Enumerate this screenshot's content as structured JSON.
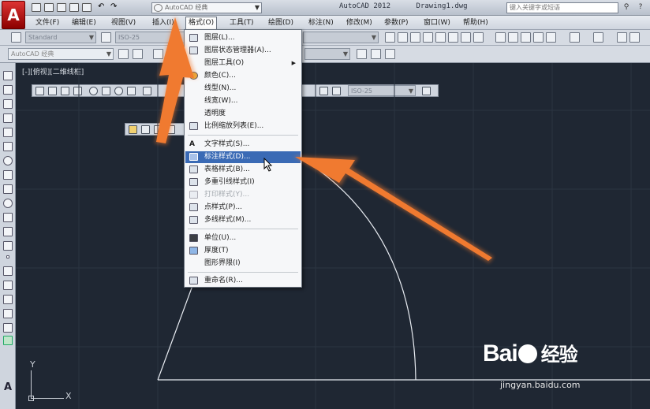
{
  "titlebar": {
    "workspace": "AutoCAD 经典",
    "app_title": "AutoCAD 2012",
    "doc_name": "Drawing1.dwg",
    "search_placeholder": "键入关键字或短语"
  },
  "menubar": {
    "items": [
      "文件(F)",
      "编辑(E)",
      "视图(V)",
      "插入(I)",
      "格式(O)",
      "工具(T)",
      "绘图(D)",
      "标注(N)",
      "修改(M)",
      "参数(P)",
      "窗口(W)",
      "帮助(H)"
    ],
    "active_index": 4
  },
  "toolbar1": {
    "text_style": "Standard",
    "dim_style": "ISO-25"
  },
  "toolbar2": {
    "workspace": "AutoCAD 经典"
  },
  "viewport": {
    "label": "[-][俯视][二维线框]",
    "dim_style_combo": "ISO-25"
  },
  "format_menu": {
    "items": [
      {
        "label": "图层(L)...",
        "icon": "layers-icon"
      },
      {
        "label": "图层状态管理器(A)...",
        "icon": "layer-state-icon"
      },
      {
        "label": "图层工具(O)",
        "icon": "",
        "submenu": true
      },
      {
        "label": "颜色(C)...",
        "icon": "color-wheel-icon"
      },
      {
        "label": "线型(N)...",
        "icon": ""
      },
      {
        "label": "线宽(W)...",
        "icon": ""
      },
      {
        "label": "透明度",
        "icon": ""
      },
      {
        "label": "比例缩放列表(E)...",
        "icon": "scale-list-icon"
      },
      {
        "label": "文字样式(S)...",
        "icon": "text-style-icon"
      },
      {
        "label": "标注样式(D)...",
        "icon": "dim-style-icon",
        "highlight": true
      },
      {
        "label": "表格样式(B)...",
        "icon": "table-style-icon"
      },
      {
        "label": "多重引线样式(I)",
        "icon": "mleader-style-icon"
      },
      {
        "label": "打印样式(Y)...",
        "icon": "plot-style-icon",
        "disabled": true
      },
      {
        "label": "点样式(P)...",
        "icon": "point-style-icon"
      },
      {
        "label": "多线样式(M)...",
        "icon": "mline-style-icon"
      },
      {
        "label": "单位(U)...",
        "icon": "units-icon"
      },
      {
        "label": "厚度(T)",
        "icon": "thickness-icon"
      },
      {
        "label": "图形界限(I)",
        "icon": ""
      },
      {
        "label": "重命名(R)...",
        "icon": "rename-icon"
      }
    ]
  },
  "ucs": {
    "y_label": "Y",
    "x_label": "X"
  },
  "watermark": {
    "brand": "Bai",
    "brand_cn": "经验",
    "url": "jingyan.baidu.com"
  },
  "colors": {
    "canvas_bg": "#1f2733",
    "menu_highlight": "#3a6ab5",
    "arrow": "#f07a30",
    "autocad_red": "#c0161b"
  }
}
